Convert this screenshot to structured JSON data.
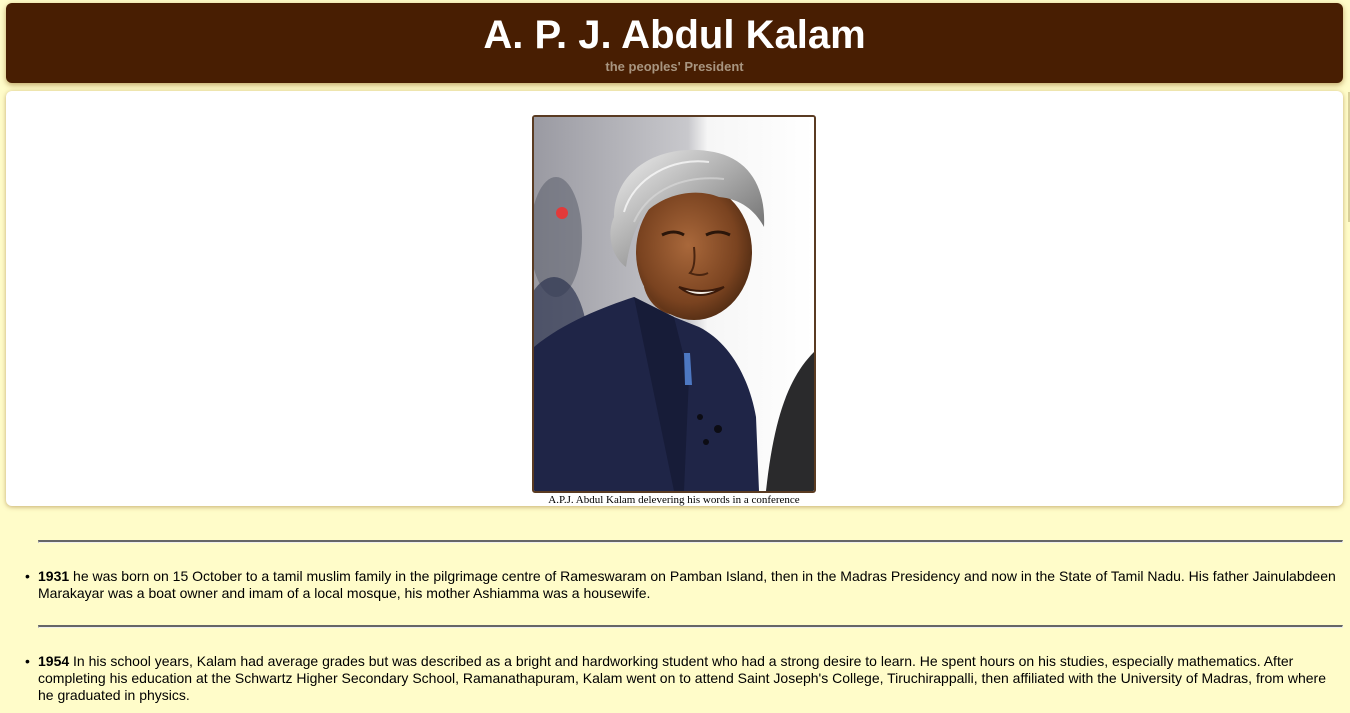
{
  "header": {
    "title": "A. P. J. Abdul Kalam",
    "subtitle": "the peoples' President"
  },
  "photo": {
    "caption": "A.P.J. Abdul Kalam delevering his words in a conference"
  },
  "timeline": [
    {
      "year": "1931",
      "text": "he was born on 15 October to a tamil muslim family in the pilgrimage centre of Rameswaram on Pamban Island, then in the Madras Presidency and now in the State of Tamil Nadu. His father Jainulabdeen Marakayar was a boat owner and imam of a local mosque, his mother Ashiamma was a housewife."
    },
    {
      "year": "1954",
      "text": "In his school years, Kalam had average grades but was described as a bright and hardworking student who had a strong desire to learn. He spent hours on his studies, especially mathematics. After completing his education at the Schwartz Higher Secondary School, Ramanathapuram, Kalam went on to attend Saint Joseph's College, Tiruchirappalli, then affiliated with the University of Madras, from where he graduated in physics."
    }
  ],
  "colors": {
    "page_background": "#fffcc9",
    "header_background": "#481e02",
    "title_color": "#ffffff",
    "subtitle_color": "#a89580",
    "photo_border": "#5a3b22"
  }
}
